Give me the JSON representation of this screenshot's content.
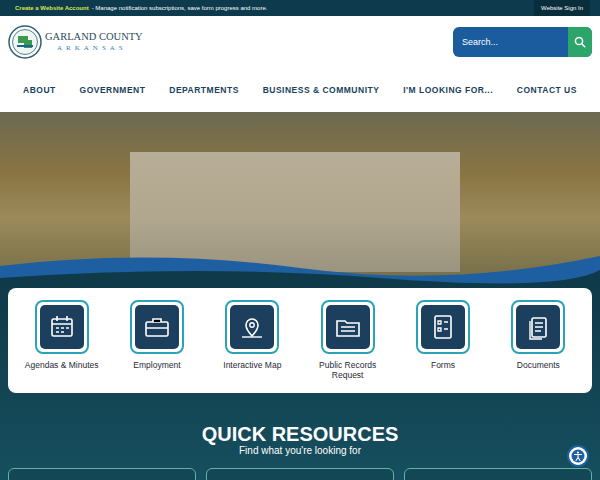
{
  "top_bar": {
    "account_link": "Create a Website Account",
    "account_text": "- Manage notification subscriptions, save form progress and more.",
    "sign_in": "Website Sign In"
  },
  "logo": {
    "name": "GARLAND COUNTY",
    "state": "ARKANSAS"
  },
  "search": {
    "placeholder": "Search..."
  },
  "nav": [
    "ABOUT",
    "GOVERNMENT",
    "DEPARTMENTS",
    "BUSINESS & COMMUNITY",
    "I'M LOOKING FOR...",
    "CONTACT US"
  ],
  "quick_links": [
    "Agendas & Minutes",
    "Employment",
    "Interactive Map",
    "Public Records Request",
    "Forms",
    "Documents"
  ],
  "resources": {
    "title": "QUICK RESOURCES",
    "subtitle": "Find what you're looking for"
  }
}
